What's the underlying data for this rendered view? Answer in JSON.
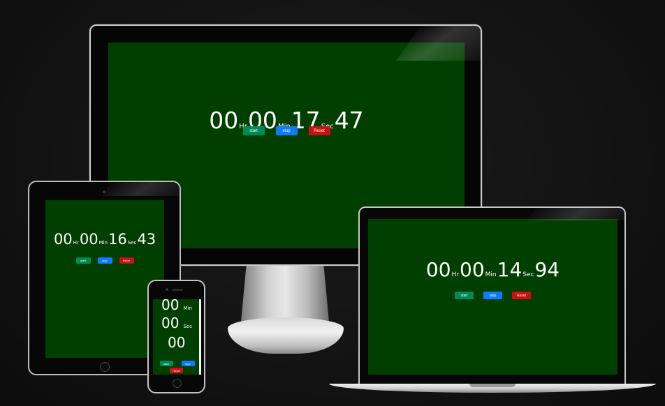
{
  "desktop": {
    "hours": "00",
    "hr_label": "Hr",
    "minutes": "00",
    "min_label": "Min",
    "seconds": "17",
    "sec_label": "Sec",
    "centis": "47",
    "start_label": "start",
    "stop_label": "stop",
    "reset_label": "Reset"
  },
  "laptop": {
    "hours": "00",
    "hr_label": "Hr",
    "minutes": "00",
    "min_label": "Min",
    "seconds": "14",
    "sec_label": "Sec",
    "centis": "94",
    "start_label": "start",
    "stop_label": "stop",
    "reset_label": "Reset"
  },
  "tablet": {
    "hours": "00",
    "hr_label": "Hr",
    "minutes": "00",
    "min_label": "Min",
    "seconds": "16",
    "sec_label": "Sec",
    "centis": "43",
    "start_label": "start",
    "stop_label": "stop",
    "reset_label": "Reset"
  },
  "phone": {
    "minutes": "00",
    "min_label": "Min",
    "seconds": "00",
    "sec_label": "Sec",
    "centis": "00",
    "start_label": "start",
    "stop_label": "stop",
    "reset_label": "Reset"
  },
  "colors": {
    "screen_bg": "#003f00",
    "start": "#008a5a",
    "stop": "#0d7bff",
    "reset": "#cc1010"
  }
}
